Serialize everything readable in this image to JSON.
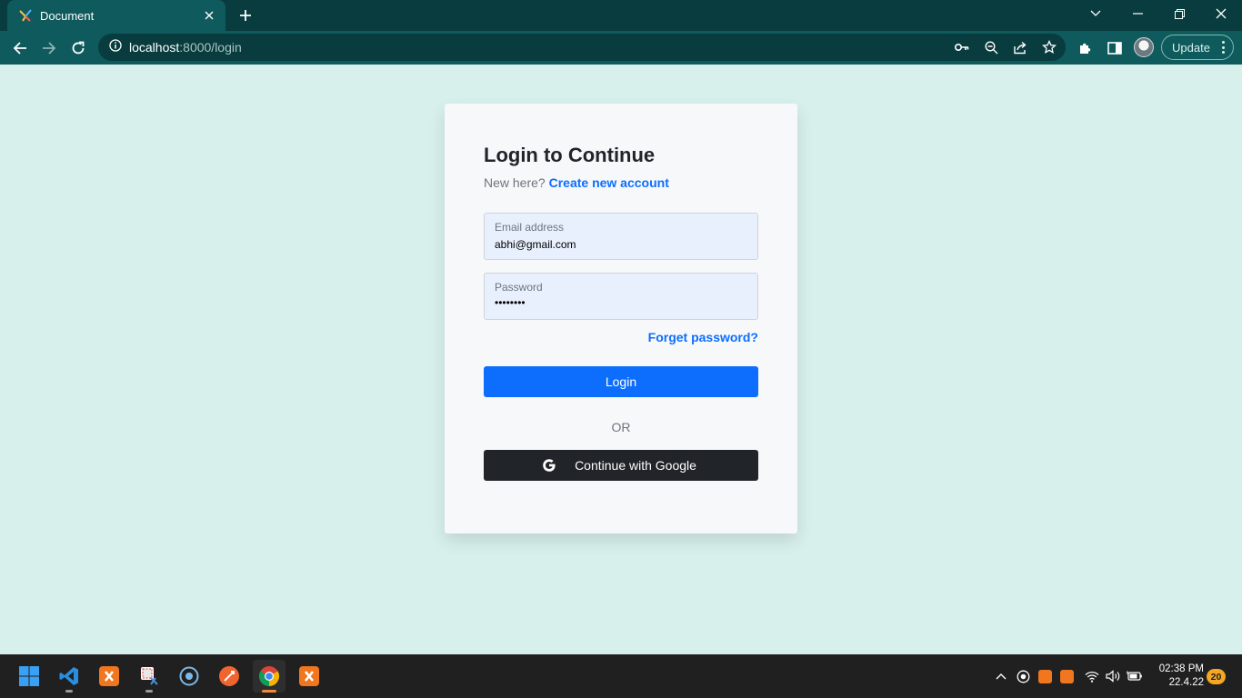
{
  "browser": {
    "tab_title": "Document",
    "url_host": "localhost",
    "url_rest": ":8000/login",
    "update_label": "Update",
    "accent": "#0f5a5c"
  },
  "login": {
    "title": "Login to Continue",
    "new_here": "New here?",
    "create_account": "Create new account",
    "email_label": "Email address",
    "email_value": "abhi@gmail.com",
    "password_label": "Password",
    "password_value": "••••••••",
    "forget_password": "Forget password?",
    "login_button": "Login",
    "or_text": "OR",
    "google_button": "Continue with Google",
    "primary_color": "#0d6efd",
    "dark_color": "#212529"
  },
  "taskbar": {
    "apps": [
      "windows-start-icon",
      "vscode-icon",
      "xampp-icon",
      "snipping-tool-icon",
      "cortana-icon",
      "postman-icon",
      "chrome-icon",
      "xampp-icon"
    ],
    "time": "02:38 PM",
    "date": "22.4.22",
    "notification_count": "20"
  }
}
